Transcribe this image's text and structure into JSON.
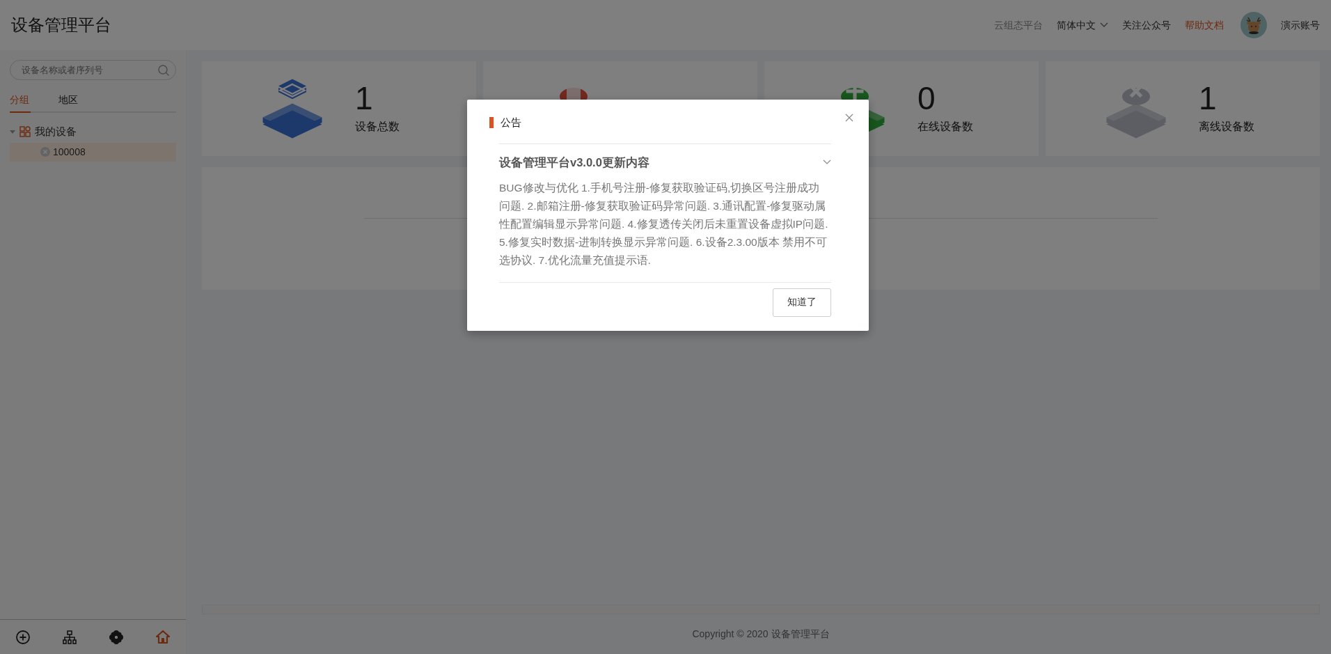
{
  "header": {
    "title": "设备管理平台",
    "links": [
      {
        "label": "云组态平台",
        "kind": "muted"
      },
      {
        "label": "简体中文",
        "kind": "dropdown"
      },
      {
        "label": "关注公众号",
        "kind": "plain"
      },
      {
        "label": "帮助文档",
        "kind": "accent"
      }
    ],
    "account": "演示账号"
  },
  "sidebar": {
    "search": {
      "placeholder": "设备名称或者序列号"
    },
    "tabs": [
      {
        "label": "分组",
        "selected": true
      },
      {
        "label": "地区",
        "selected": false
      }
    ],
    "tree": [
      {
        "label": "我的设备",
        "expanded": true,
        "children": [
          {
            "label": "100008",
            "online": false,
            "selected": true
          }
        ]
      }
    ],
    "bottom_icons": [
      {
        "kind": "add",
        "selected": false
      },
      {
        "kind": "hierarchy",
        "selected": false
      },
      {
        "kind": "flower",
        "selected": false
      },
      {
        "kind": "home",
        "selected": true
      }
    ]
  },
  "stats": [
    {
      "kind": "layers",
      "value": "1",
      "label": "设备总数"
    },
    {
      "kind": "doc"
    },
    {
      "kind": "plus",
      "value": "0",
      "label": "在线设备数"
    },
    {
      "kind": "cross",
      "value": "1",
      "label": "离线设备数"
    }
  ],
  "modal": {
    "title": "公告",
    "section_title": "设备管理平台v3.0.0更新内容",
    "expanded": true,
    "body": "BUG修改与优化 1.手机号注册-修复获取验证码,切换区号注册成功问题. 2.邮箱注册-修复获取验证码异常问题. 3.通讯配置-修复驱动属性配置编辑显示异常问题. 4.修复透传关闭后未重置设备虚拟IP问题. 5.修复实时数据-进制转换显示异常问题. 6.设备2.3.00版本 禁用不可选协议. 7.优化流量充值提示语.",
    "button": "知道了"
  },
  "footer": "Copyright © 2020 设备管理平台"
}
